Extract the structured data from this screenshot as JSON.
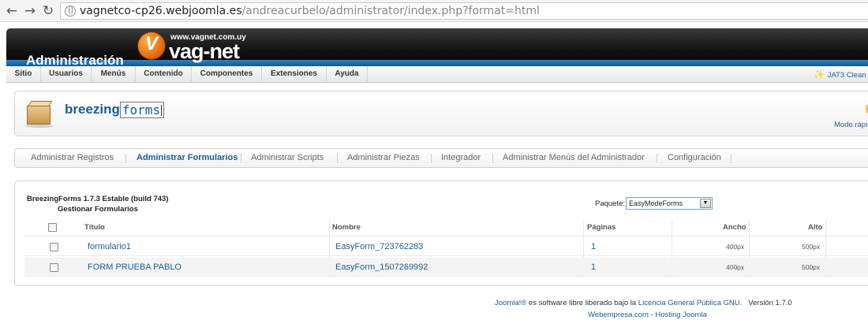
{
  "browser": {
    "url_host": "vagnetco-cp26.webjoomla.es",
    "url_path": "/andreacurbelo/administrator/index.php?format=html"
  },
  "header": {
    "title": "Administración",
    "logo_url": "www.vagnet.com.uy",
    "logo_text": "vag-net"
  },
  "menu": {
    "items": [
      "Sitio",
      "Usuarios",
      "Menús",
      "Contenido",
      "Componentes",
      "Extensiones",
      "Ayuda"
    ],
    "template_indicator": "JAT3 Clean"
  },
  "toolbar": {
    "logo_part1": "breezing",
    "logo_part2": "forms",
    "quick_mode": "Modo rápi"
  },
  "submenu": {
    "items": [
      "Administrar Registros",
      "Administrar Formularios",
      "Administrar Scripts",
      "Administrar Piezas",
      "Integrador",
      "Administrar Menús del Administrador",
      "Configuración"
    ],
    "active_index": 1
  },
  "panel": {
    "version": "BreezingForms 1.7.3 Estable (build 743)",
    "subtitle": "Gestionar Formularios",
    "package_label": "Paquete:",
    "package_value": "EasyModeForms",
    "columns": [
      "Título",
      "Nombre",
      "Páginas",
      "Ancho",
      "Alto"
    ],
    "rows": [
      {
        "titulo": "formulario1",
        "nombre": "EasyForm_723762283",
        "paginas": "1",
        "ancho": "400px",
        "alto": "500px"
      },
      {
        "titulo": "FORM PRUEBA PABLO",
        "nombre": "EasyForm_1507269992",
        "paginas": "1",
        "ancho": "400px",
        "alto": "500px"
      }
    ]
  },
  "footer": {
    "joomla": "Joomla!®",
    "text1": " es software libre liberado bajo la ",
    "license": "Licencia General Pública GNU.",
    "version": "Versión 1.7.0",
    "webempresa": "Webempresa.com",
    "sep": " - ",
    "hosting": "Hosting Joomla"
  }
}
